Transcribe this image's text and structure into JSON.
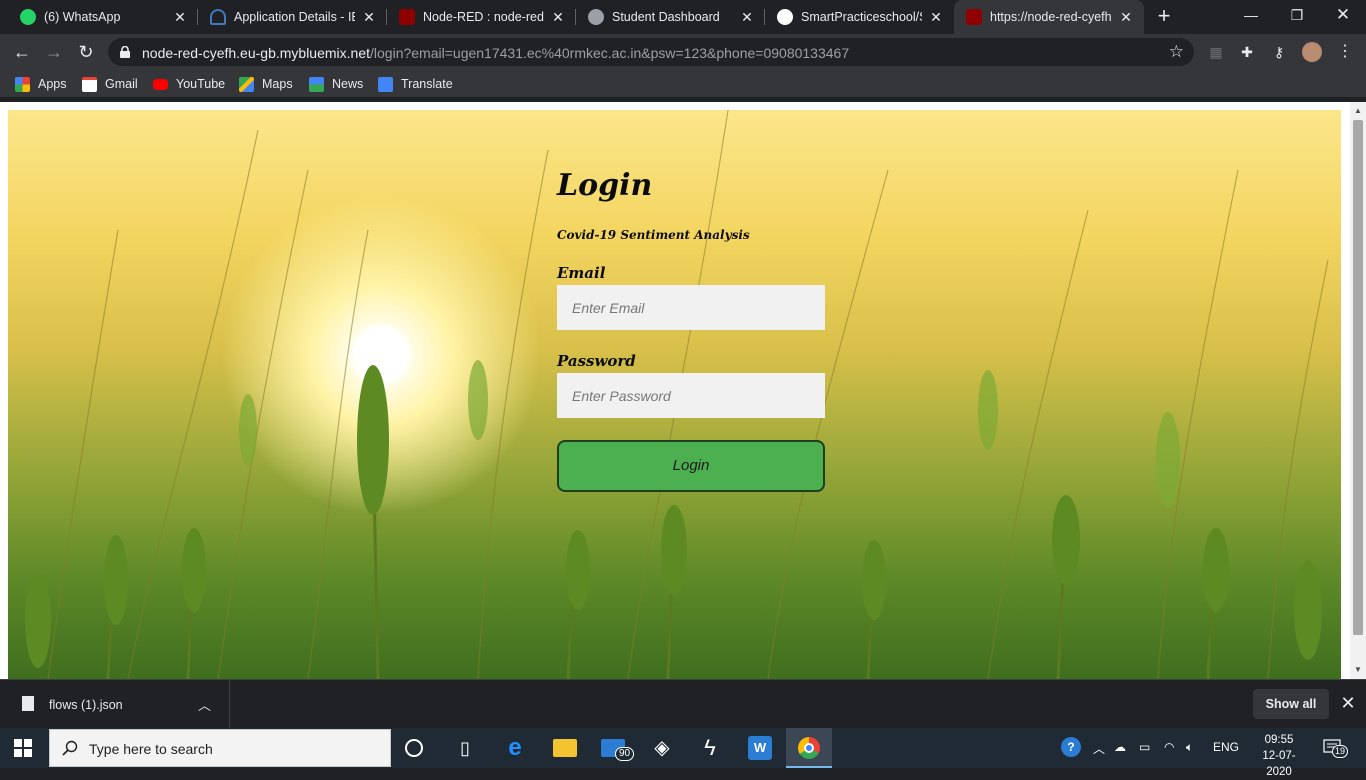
{
  "browser": {
    "tabs": [
      {
        "title": "(6) WhatsApp",
        "icon": "whatsapp-icon",
        "color": "#25d366"
      },
      {
        "title": "Application Details - IBM",
        "icon": "ibm-cloud-icon",
        "color": "#4178be"
      },
      {
        "title": "Node-RED : node-red-c",
        "icon": "node-red-icon",
        "color": "#8f0000"
      },
      {
        "title": "Student Dashboard",
        "icon": "globe-icon",
        "color": "#9aa0a6"
      },
      {
        "title": "SmartPracticeschool/SB",
        "icon": "github-icon",
        "color": "#ffffff"
      },
      {
        "title": "https://node-red-cyefh.",
        "icon": "node-red-icon",
        "color": "#8f0000",
        "active": true
      }
    ],
    "url_host": "node-red-cyefh.eu-gb.mybluemix.net",
    "url_path": "/login?email=ugen17431.ec%40rmkec.ac.in&psw=123&phone=09080133467",
    "bookmarks": [
      {
        "label": "Apps",
        "icon": "apps-grid-icon"
      },
      {
        "label": "Gmail",
        "icon": "gmail-icon"
      },
      {
        "label": "YouTube",
        "icon": "youtube-icon"
      },
      {
        "label": "Maps",
        "icon": "maps-icon"
      },
      {
        "label": "News",
        "icon": "news-icon"
      },
      {
        "label": "Translate",
        "icon": "translate-icon"
      }
    ]
  },
  "page": {
    "title": "Login",
    "subtitle": "Covid-19 Sentiment Analysis",
    "email_label": "Email",
    "email_placeholder": "Enter Email",
    "password_label": "Password",
    "password_placeholder": "Enter Password",
    "login_button": "Login",
    "button_color": "#4caf50"
  },
  "downloads": {
    "file_name": "flows (1).json",
    "show_all": "Show all"
  },
  "taskbar": {
    "search_placeholder": "Type here to search",
    "mail_badge": "90",
    "language": "ENG",
    "time": "09:55",
    "date": "12-07-2020",
    "notifications": "19"
  }
}
